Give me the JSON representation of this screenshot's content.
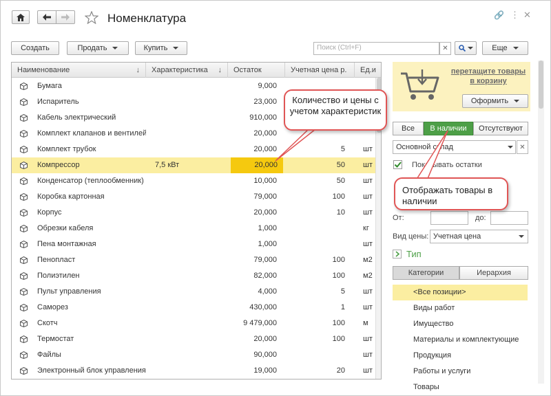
{
  "window": {
    "title": "Номенклатура"
  },
  "toolbar": {
    "create": "Создать",
    "sell": "Продать",
    "buy": "Купить",
    "search_placeholder": "Поиск (Ctrl+F)",
    "more": "Еще"
  },
  "table": {
    "headers": [
      "Наименование",
      "Характеристика",
      "Остаток",
      "Учетная цена р.",
      "Ед.и"
    ],
    "rows": [
      {
        "name": "Бумага",
        "char": "",
        "stock": "9,000",
        "price": "",
        "unit": ""
      },
      {
        "name": "Испаритель",
        "char": "",
        "stock": "23,000",
        "price": "",
        "unit": ""
      },
      {
        "name": "Кабель электрический",
        "char": "",
        "stock": "910,000",
        "price": "",
        "unit": ""
      },
      {
        "name": "Комплект клапанов и вентилей",
        "char": "",
        "stock": "20,000",
        "price": "",
        "unit": ""
      },
      {
        "name": "Комплект трубок",
        "char": "",
        "stock": "20,000",
        "price": "5",
        "unit": "шт"
      },
      {
        "name": "Компрессор",
        "char": "7,5 кВт",
        "stock": "20,000",
        "price": "50",
        "unit": "шт"
      },
      {
        "name": "Конденсатор (теплообменник)",
        "char": "",
        "stock": "10,000",
        "price": "50",
        "unit": "шт"
      },
      {
        "name": "Коробка картонная",
        "char": "",
        "stock": "79,000",
        "price": "100",
        "unit": "шт"
      },
      {
        "name": "Корпус",
        "char": "",
        "stock": "20,000",
        "price": "10",
        "unit": "шт"
      },
      {
        "name": "Обрезки кабеля",
        "char": "",
        "stock": "1,000",
        "price": "",
        "unit": "кг"
      },
      {
        "name": "Пена монтажная",
        "char": "",
        "stock": "1,000",
        "price": "",
        "unit": "шт"
      },
      {
        "name": "Пенопласт",
        "char": "",
        "stock": "79,000",
        "price": "100",
        "unit": "м2"
      },
      {
        "name": "Полиэтилен",
        "char": "",
        "stock": "82,000",
        "price": "100",
        "unit": "м2"
      },
      {
        "name": "Пульт управления",
        "char": "",
        "stock": "4,000",
        "price": "5",
        "unit": "шт"
      },
      {
        "name": "Саморез",
        "char": "",
        "stock": "430,000",
        "price": "1",
        "unit": "шт"
      },
      {
        "name": "Скотч",
        "char": "",
        "stock": "9 479,000",
        "price": "100",
        "unit": "м"
      },
      {
        "name": "Термостат",
        "char": "",
        "stock": "20,000",
        "price": "100",
        "unit": "шт"
      },
      {
        "name": "Файлы",
        "char": "",
        "stock": "90,000",
        "price": "",
        "unit": "шт"
      },
      {
        "name": "Электронный блок управления",
        "char": "",
        "stock": "19,000",
        "price": "20",
        "unit": "шт"
      }
    ]
  },
  "cart": {
    "link": "перетащите товары в корзину",
    "checkout": "Оформить"
  },
  "availability_tabs": [
    "Все",
    "В наличии",
    "Отсутствуют"
  ],
  "warehouse": "Основной склад",
  "show_stock": "Показывать остатки",
  "price_filter": {
    "from": "От:",
    "to": "до:"
  },
  "price_type": {
    "label": "Вид цены:",
    "value": "Учетная цена"
  },
  "type_section": "Тип",
  "category_tabs": [
    "Категории",
    "Иерархия"
  ],
  "categories": [
    "<Все позиции>",
    "Виды работ",
    "Имущество",
    "Материалы и комплектующие",
    "Продукция",
    "Работы и услуги",
    "Товары"
  ],
  "callouts": {
    "top": "Количество и цены с учетом характеристик",
    "bottom": "Отображать товары в наличии"
  },
  "colors": {
    "accent_green": "#4d9f47",
    "selection": "#fbeea1",
    "highlight": "#f5c90f",
    "callout_border": "#e05555",
    "cart_bg": "#fcf2bf"
  }
}
